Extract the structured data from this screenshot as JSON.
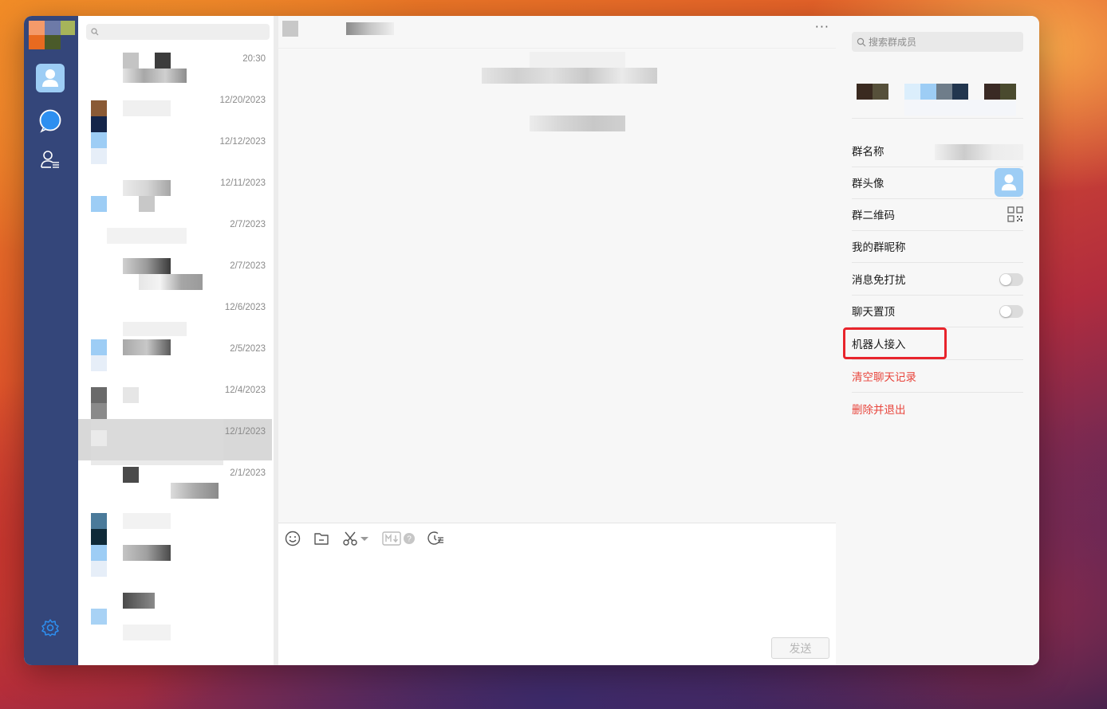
{
  "colors": {
    "rail": "#34467a",
    "active_nav": "#9dcdf5",
    "danger": "#e8453c",
    "highlight": "#e8242c",
    "selected_row": "#d8d8d8"
  },
  "nav": [
    {
      "name": "contacts",
      "icon": "user-icon",
      "active": true
    },
    {
      "name": "messages",
      "icon": "chat-bubble-icon",
      "active": false
    },
    {
      "name": "organization",
      "icon": "user-list-icon",
      "active": false
    }
  ],
  "nav_bottom_icon": "gear-icon",
  "chat_list": {
    "search_placeholder": "",
    "items": [
      {
        "date": "20:30",
        "selected": false
      },
      {
        "date": "12/20/2023",
        "selected": false
      },
      {
        "date": "12/12/2023",
        "selected": false
      },
      {
        "date": "12/11/2023",
        "selected": false
      },
      {
        "date": "2/7/2023",
        "selected": false
      },
      {
        "date": "2/7/2023",
        "selected": false
      },
      {
        "date": "12/6/2023",
        "selected": false
      },
      {
        "date": "2/5/2023",
        "selected": false
      },
      {
        "date": "12/4/2023",
        "selected": false
      },
      {
        "date": "12/1/2023",
        "selected": true
      },
      {
        "date": "2/1/2023",
        "selected": false
      }
    ]
  },
  "chat": {
    "more_label": "···",
    "tools": [
      "emoji-icon",
      "folder-icon",
      "scissors-icon",
      "markdown-icon",
      "history-icon"
    ],
    "send_label": "发送"
  },
  "panel": {
    "search_placeholder": "搜索群成员",
    "rows": {
      "group_name": "群名称",
      "group_avatar": "群头像",
      "group_qr": "群二维码",
      "my_nickname": "我的群昵称",
      "do_not_disturb": "消息免打扰",
      "pin_chat": "聊天置顶",
      "bot_access": "机器人接入",
      "clear_history": "清空聊天记录",
      "delete_exit": "删除并退出"
    },
    "toggles": {
      "do_not_disturb": false,
      "pin_chat": false
    }
  }
}
